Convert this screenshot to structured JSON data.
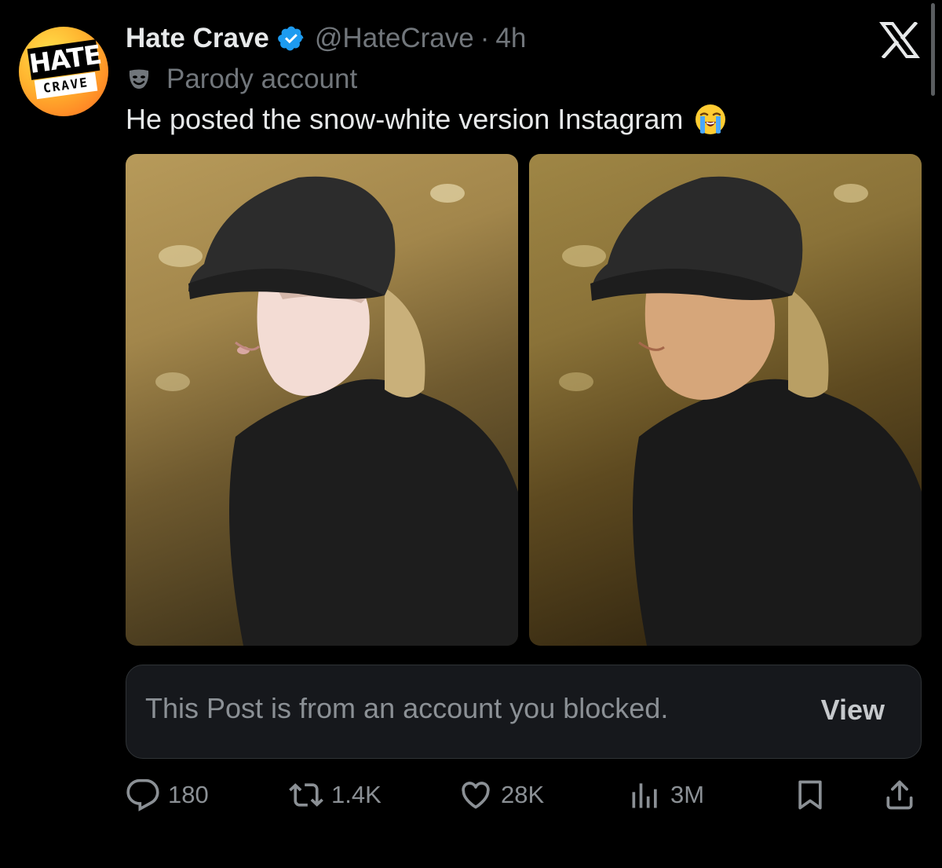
{
  "post": {
    "display_name": "Hate Crave",
    "handle": "@HateCrave",
    "separator": "·",
    "time": "4h",
    "parody_label": "Parody account",
    "text": "He posted the snow-white version Instagram",
    "avatar_logo": {
      "line1": "HATE",
      "line2": "CRAVE"
    },
    "icons": {
      "verified": "verified-badge-icon",
      "parody": "theater-mask-icon",
      "emoji": "loudly-crying-face-emoji",
      "x": "x-logo-icon"
    }
  },
  "media": [
    {
      "alt_semantic": "photo-edited-pale"
    },
    {
      "alt_semantic": "photo-original"
    }
  ],
  "blocked_notice": {
    "text": "This Post is from an account you blocked.",
    "button_label": "View"
  },
  "actions": {
    "replies": "180",
    "reposts": "1.4K",
    "likes": "28K",
    "views": "3M"
  },
  "colors": {
    "background": "#000000",
    "primary_text": "#e7e9ea",
    "secondary_text": "#71767b",
    "verified_blue": "#1d9bf0",
    "card_bg": "#16181c",
    "card_border": "#2f3336"
  }
}
